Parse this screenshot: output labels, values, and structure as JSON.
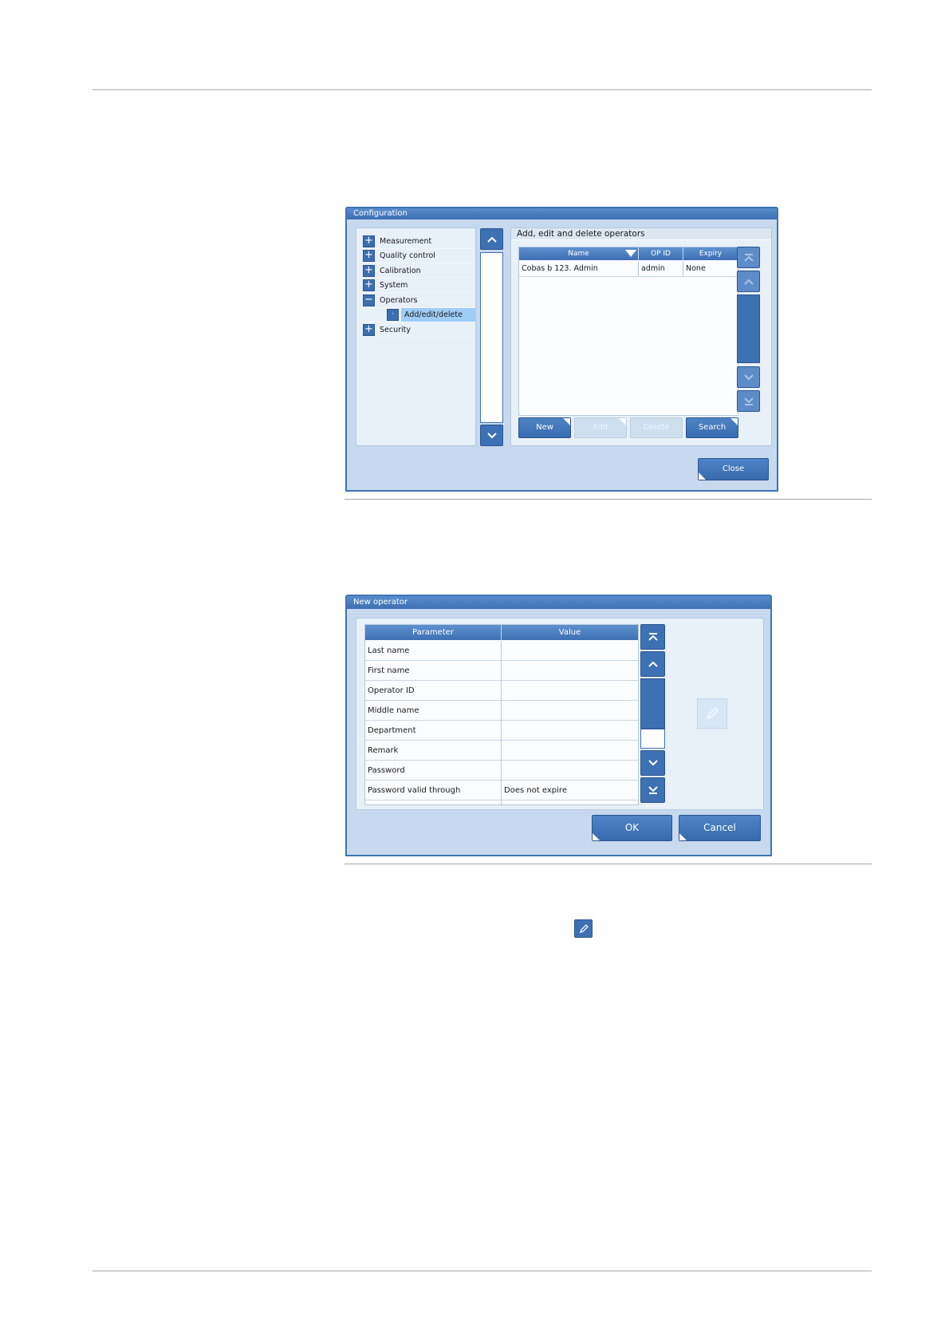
{
  "config_dialog": {
    "title": "Configuration",
    "tree": [
      {
        "label": "Measurement",
        "symbol": "+"
      },
      {
        "label": "Quality control",
        "symbol": "+"
      },
      {
        "label": "Calibration",
        "symbol": "+"
      },
      {
        "label": "System",
        "symbol": "+"
      },
      {
        "label": "Operators",
        "symbol": "−"
      },
      {
        "label": "Add/edit/delete",
        "symbol": "·",
        "selected": true
      },
      {
        "label": "Security",
        "symbol": "+"
      }
    ],
    "section_title": "Add, edit and delete operators",
    "columns": [
      "Name",
      "OP ID",
      "Expiry"
    ],
    "rows": [
      [
        "Cobas b 123. Admin",
        "admin",
        "None"
      ]
    ],
    "buttons": {
      "new": "New",
      "edit": "Edit",
      "delete": "Delete",
      "search": "Search"
    },
    "close": "Close"
  },
  "new_operator_dialog": {
    "title": "New operator",
    "columns": [
      "Parameter",
      "Value"
    ],
    "rows": [
      [
        "Last name",
        ""
      ],
      [
        "First name",
        ""
      ],
      [
        "Operator ID",
        ""
      ],
      [
        "Middle name",
        ""
      ],
      [
        "Department",
        ""
      ],
      [
        "Remark",
        ""
      ],
      [
        "Password",
        ""
      ],
      [
        "Password valid through",
        "Does not expire"
      ]
    ],
    "ok": "OK",
    "cancel": "Cancel"
  },
  "colors": {
    "accent": "#3e71b4",
    "window_bg": "#c7d9ee",
    "selected": "#9fcdf6"
  },
  "icons": [
    "plus-icon",
    "minus-icon",
    "chevron-up-icon",
    "chevron-down-icon",
    "skip-top-icon",
    "skip-bottom-icon",
    "pencil-icon"
  ]
}
